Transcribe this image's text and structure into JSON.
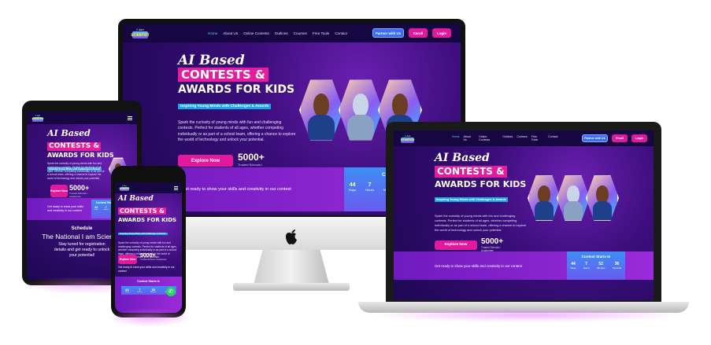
{
  "logo": {
    "top": "I Am",
    "brand": "SCIENTIST"
  },
  "nav": {
    "links": [
      "Home",
      "About Us",
      "Online Contests",
      "Outlines",
      "Courses",
      "Free Tools",
      "Contact"
    ],
    "partner": "Partner with Us",
    "enroll": "Enroll",
    "login": "Login"
  },
  "hero": {
    "title1": "AI Based",
    "title2": "CONTESTS &",
    "title3": "AWARDS FOR KIDS",
    "tagline": "Inspiring Young Minds with Challenges & Awards",
    "desc": "Spark the curiosity of young minds with fun and challenging contests. Perfect for students of all ages, whether competing individually or as part of a school team, offering a chance to explore the world of technology and unlock your potential.",
    "cta": "Explore Now",
    "trusted_num": "5000+",
    "trusted_lbl": "Trusted Schools / Academies"
  },
  "band": {
    "text": "Get ready to show your skills and creativity in our contest"
  },
  "countdown": {
    "title": "Contest Starts In",
    "days": "44",
    "hours": "7",
    "minutes": "52",
    "seconds": "36",
    "l_days": "Days",
    "l_hours": "Hours",
    "l_minutes": "Minutes",
    "l_seconds": "Seconds"
  },
  "schedule": {
    "title": "Schedule",
    "heading": "The National I am Scientist",
    "sub": "Stay tuned for registration details and get ready to unlock your potential!"
  },
  "colors": {
    "accent": "#e0199d",
    "primary": "#3b6df5",
    "bg_dark": "#1d0752"
  }
}
